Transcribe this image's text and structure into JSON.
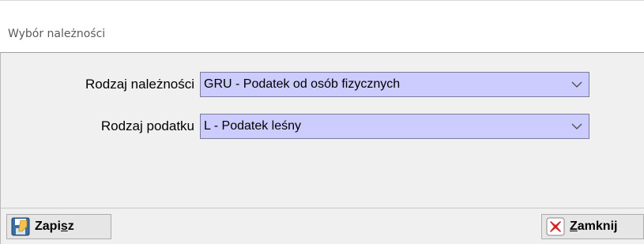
{
  "window": {
    "title": "Wybór należności"
  },
  "form": {
    "rodzaj_naleznosci": {
      "label": "Rodzaj należności",
      "value": "GRU - Podatek od osób fizycznych"
    },
    "rodzaj_podatku": {
      "label": "Rodzaj podatku",
      "value": "L - Podatek leśny"
    }
  },
  "buttons": {
    "save": {
      "prefix": "Zapi",
      "accel": "s",
      "suffix": "z",
      "icon": "save-disk-icon"
    },
    "close": {
      "prefix": "",
      "accel": "Z",
      "suffix": "amknij",
      "icon": "red-x-close-icon"
    }
  },
  "colors": {
    "select_bg": "#ccccff",
    "close_icon": "#d42020"
  }
}
